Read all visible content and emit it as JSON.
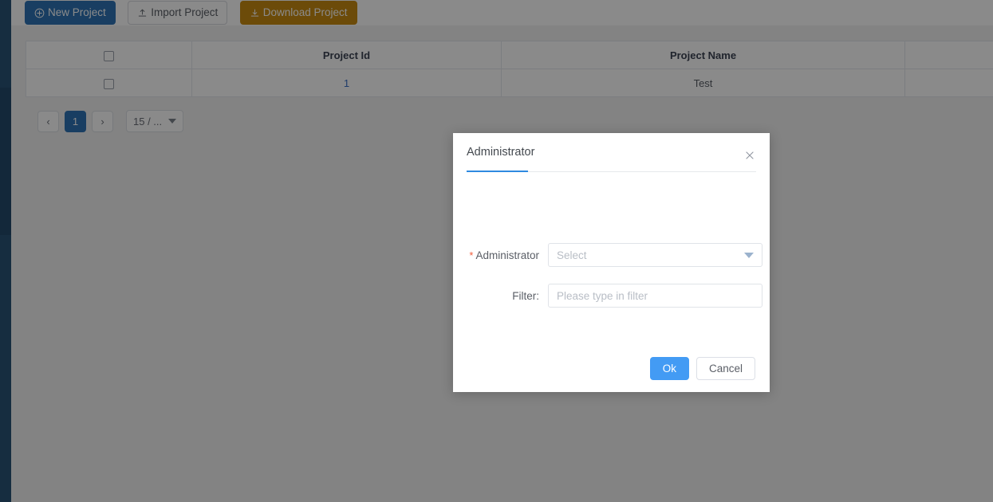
{
  "toolbar": {
    "new_project": {
      "label": "New Project",
      "icon": "plus-circle-icon"
    },
    "import_project": {
      "label": "Import Project",
      "icon": "upload-icon"
    },
    "download_project": {
      "label": "Download Project",
      "icon": "download-icon"
    }
  },
  "table": {
    "columns": [
      "",
      "Project Id",
      "Project Name",
      ""
    ],
    "rows": [
      {
        "id": "1",
        "name": "Test",
        "extra": ""
      }
    ]
  },
  "pagination": {
    "prev": "‹",
    "next": "›",
    "current_page": "1",
    "page_size_label": "15 / ..."
  },
  "dialog": {
    "title": "Administrator",
    "close_icon": "close-icon",
    "fields": {
      "administrator": {
        "label": "Administrator",
        "required_marker": "*",
        "placeholder": "Select",
        "value": "",
        "caret_icon": "chevron-down-icon"
      },
      "filter": {
        "label": "Filter:",
        "placeholder": "Please type in filter",
        "value": ""
      }
    },
    "buttons": {
      "ok": "Ok",
      "cancel": "Cancel"
    }
  },
  "colors": {
    "primary": "#2f74b5",
    "warn": "#c88b12",
    "accent": "#439bf4",
    "tab_indicator": "#2f8ae0",
    "required": "#f25c3a",
    "link": "#3a6fc4",
    "nav_rail": "#2a5477"
  }
}
